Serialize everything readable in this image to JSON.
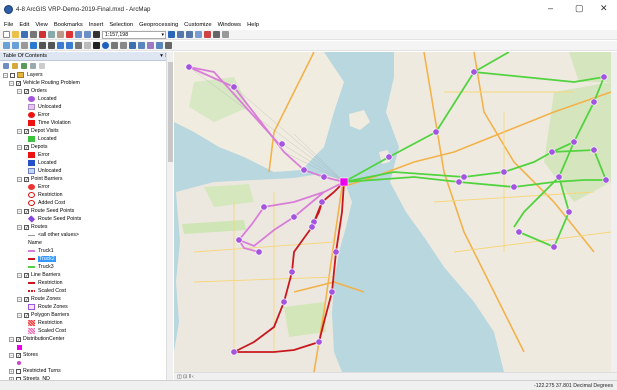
{
  "window": {
    "title": "4-8 ArcGIS VRP-Demo-2019-Final.mxd - ArcMap",
    "controls": [
      "–",
      "▢",
      "✕"
    ]
  },
  "menu": [
    "File",
    "Edit",
    "View",
    "Bookmarks",
    "Insert",
    "Selection",
    "Geoprocessing",
    "Customize",
    "Windows",
    "Help"
  ],
  "toolbar": {
    "scale": "1:157,198"
  },
  "toc": {
    "title": "Table Of Contents",
    "pin": "▾ ✕",
    "items": [
      {
        "label": "Layers",
        "level": 0,
        "exp": "−",
        "cb": false,
        "sym": "folder"
      },
      {
        "label": "Vehicle Routing Problem",
        "level": 1,
        "exp": "−",
        "cb": true,
        "sym": "none"
      },
      {
        "label": "Orders",
        "level": 2,
        "exp": "−",
        "cb": true,
        "sym": "none"
      },
      {
        "label": "Located",
        "level": 3,
        "sym": "circle-purple"
      },
      {
        "label": "Unlocated",
        "level": 3,
        "sym": "q-lilac"
      },
      {
        "label": "Error",
        "level": 3,
        "sym": "circle-red"
      },
      {
        "label": "Time Violation",
        "level": 3,
        "sym": "sq-red"
      },
      {
        "label": "Depot Visits",
        "level": 2,
        "exp": "−",
        "cb": true,
        "sym": "none"
      },
      {
        "label": "Located",
        "level": 3,
        "sym": "sq-green"
      },
      {
        "label": "Depots",
        "level": 2,
        "exp": "−",
        "cb": true,
        "sym": "none"
      },
      {
        "label": "Error",
        "level": 3,
        "sym": "sq-red"
      },
      {
        "label": "Located",
        "level": 3,
        "sym": "sq-blue"
      },
      {
        "label": "Unlocated",
        "level": 3,
        "sym": "q-blue"
      },
      {
        "label": "Point Barriers",
        "level": 2,
        "exp": "−",
        "cb": true,
        "sym": "none"
      },
      {
        "label": "Error",
        "level": 3,
        "sym": "q-red"
      },
      {
        "label": "Restriction",
        "level": 3,
        "sym": "x-red"
      },
      {
        "label": "Added Cost",
        "level": 3,
        "sym": "ring-red"
      },
      {
        "label": "Route Seed Points",
        "level": 2,
        "exp": "−",
        "cb": true,
        "sym": "none"
      },
      {
        "label": "Route Seed Points",
        "level": 3,
        "sym": "star-purple"
      },
      {
        "label": "Routes",
        "level": 2,
        "exp": "−",
        "cb": true,
        "sym": "none"
      },
      {
        "label": "<all other values>",
        "level": 3,
        "sym": "line-gray"
      },
      {
        "label": "Name",
        "level": 3,
        "sym": "none"
      },
      {
        "label": "Truck1",
        "level": 3,
        "sym": "line-pink"
      },
      {
        "label": "Truck2",
        "level": 3,
        "sym": "line-red",
        "selected": true
      },
      {
        "label": "Truck3",
        "level": 3,
        "sym": "line-green"
      },
      {
        "label": "Line Barriers",
        "level": 2,
        "exp": "−",
        "cb": true,
        "sym": "none"
      },
      {
        "label": "Restriction",
        "level": 3,
        "sym": "line-red"
      },
      {
        "label": "Scaled Cost",
        "level": 3,
        "sym": "line-dash-red"
      },
      {
        "label": "Route Zones",
        "level": 2,
        "exp": "−",
        "cb": true,
        "sym": "none"
      },
      {
        "label": "Route Zones",
        "level": 3,
        "sym": "sq-outline-purple"
      },
      {
        "label": "Polygon Barriers",
        "level": 2,
        "exp": "−",
        "cb": true,
        "sym": "none"
      },
      {
        "label": "Restriction",
        "level": 3,
        "sym": "sq-hatch-red"
      },
      {
        "label": "Scaled Cost",
        "level": 3,
        "sym": "sq-hatch-pink"
      },
      {
        "label": "DistributionCenter",
        "level": 1,
        "exp": "−",
        "cb": true,
        "sym": "none"
      },
      {
        "label": "",
        "level": 2,
        "sym": "sq-magenta"
      },
      {
        "label": "Stores",
        "level": 1,
        "exp": "−",
        "cb": true,
        "sym": "none"
      },
      {
        "label": "",
        "level": 2,
        "sym": "dot-magenta"
      },
      {
        "label": "Restricted Turns",
        "level": 1,
        "exp": "+",
        "cb": false,
        "sym": "none"
      },
      {
        "label": "Streets_ND",
        "level": 1,
        "exp": "+",
        "cb": false,
        "sym": "none"
      }
    ]
  },
  "map_hscroll": "◫ ⊡ ‖ ‹",
  "status": {
    "coords": "-122.275  37.801 Decimal Degrees"
  }
}
